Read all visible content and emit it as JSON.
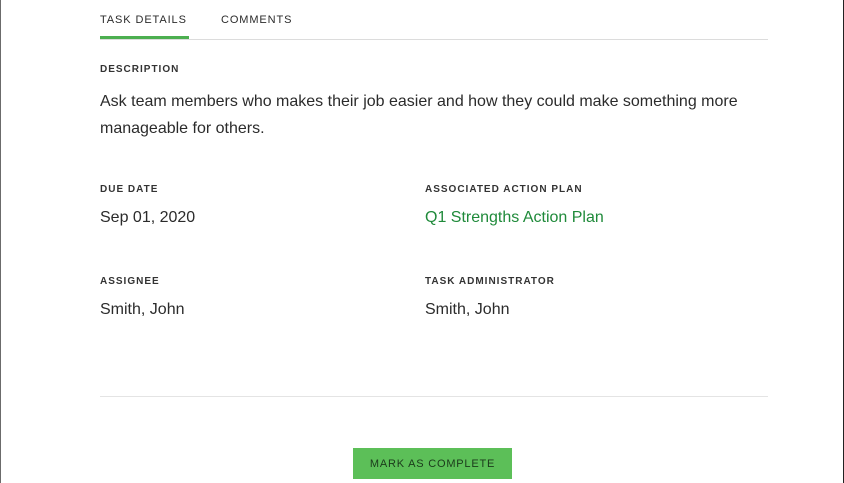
{
  "tabs": {
    "details_label": "TASK DETAILS",
    "comments_label": "COMMENTS",
    "active": "TASK DETAILS"
  },
  "description": {
    "label": "DESCRIPTION",
    "text": "Ask team members who makes their job easier and how they could make something more manageable for others."
  },
  "due_date": {
    "label": "DUE DATE",
    "value": "Sep 01, 2020"
  },
  "action_plan": {
    "label": "ASSOCIATED ACTION PLAN",
    "value": "Q1 Strengths Action Plan"
  },
  "assignee": {
    "label": "ASSIGNEE",
    "value": "Smith, John"
  },
  "administrator": {
    "label": "TASK ADMINISTRATOR",
    "value": "Smith, John"
  },
  "actions": {
    "complete_label": "MARK AS COMPLETE"
  },
  "colors": {
    "accent": "#4caf50",
    "link": "#1f8a3a",
    "button": "#5cbf58"
  }
}
